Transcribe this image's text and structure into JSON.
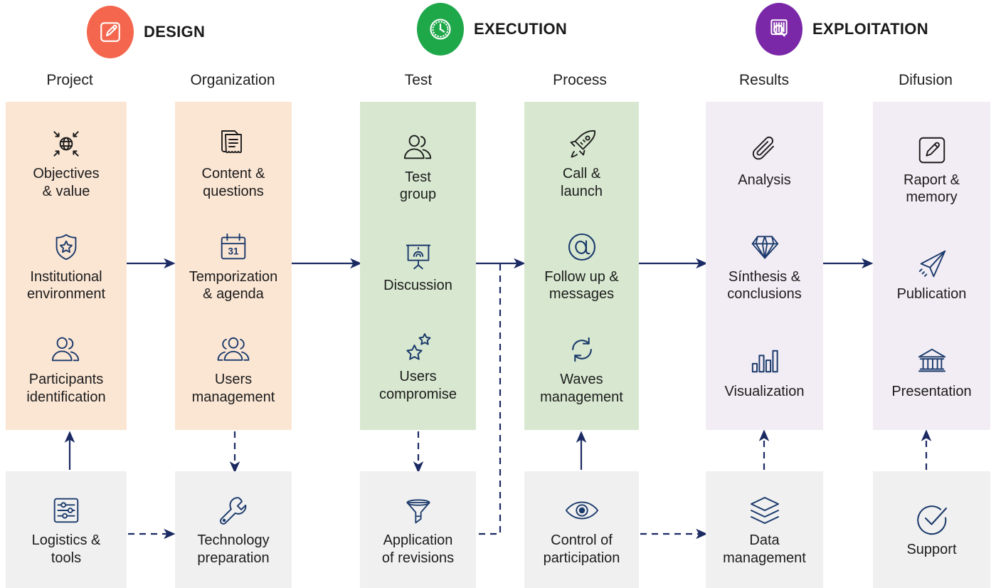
{
  "phases": [
    {
      "id": "design",
      "label": "DESIGN",
      "icon": "pencil-square-icon",
      "color": "#f4674e"
    },
    {
      "id": "execution",
      "label": "EXECUTION",
      "icon": "clock-icon",
      "color": "#1fa84a"
    },
    {
      "id": "exploitation",
      "label": "EXPLOITATION",
      "icon": "barcode-search-icon",
      "color": "#7b28a8"
    }
  ],
  "columns": [
    {
      "id": "project",
      "title": "Project"
    },
    {
      "id": "organization",
      "title": "Organization"
    },
    {
      "id": "test",
      "title": "Test"
    },
    {
      "id": "process",
      "title": "Process"
    },
    {
      "id": "results",
      "title": "Results"
    },
    {
      "id": "difusion",
      "title": "Difusion"
    }
  ],
  "main_boxes": [
    {
      "column": "project",
      "tint": "#fbe6d4",
      "items": [
        {
          "icon": "globe-target-icon",
          "label": "Objectives\n& value"
        },
        {
          "icon": "shield-star-icon",
          "label": "Institutional\nenvironment"
        },
        {
          "icon": "two-users-icon",
          "label": "Participants\nidentification"
        }
      ]
    },
    {
      "column": "organization",
      "tint": "#fbe6d4",
      "items": [
        {
          "icon": "document-stack-icon",
          "label": "Content &\nquestions"
        },
        {
          "icon": "calendar-31-icon",
          "label": "Temporization\n& agenda"
        },
        {
          "icon": "three-users-icon",
          "label": "Users\nmanagement"
        }
      ]
    },
    {
      "column": "test",
      "tint": "#d8e8d0",
      "items": [
        {
          "icon": "two-users-icon",
          "label": "Test\ngroup"
        },
        {
          "icon": "presentation-icon",
          "label": "Discussion"
        },
        {
          "icon": "stars-icon",
          "label": "Users\ncompromise"
        }
      ]
    },
    {
      "column": "process",
      "tint": "#d8e8d0",
      "items": [
        {
          "icon": "rocket-icon",
          "label": "Call &\nlaunch"
        },
        {
          "icon": "at-sign-icon",
          "label": "Follow up &\nmessages"
        },
        {
          "icon": "refresh-cycle-icon",
          "label": "Waves\nmanagement"
        }
      ]
    },
    {
      "column": "results",
      "tint": "#f2edf4",
      "items": [
        {
          "icon": "paperclip-icon",
          "label": "Analysis"
        },
        {
          "icon": "diamond-icon",
          "label": "Sínthesis &\nconclusions"
        },
        {
          "icon": "bar-chart-icon",
          "label": "Visualization"
        }
      ]
    },
    {
      "column": "difusion",
      "tint": "#f2edf4",
      "items": [
        {
          "icon": "pencil-square-outline-icon",
          "label": "Raport &\nmemory"
        },
        {
          "icon": "paper-plane-icon",
          "label": "Publication"
        },
        {
          "icon": "bank-icon",
          "label": "Presentation"
        }
      ]
    }
  ],
  "support_boxes": [
    {
      "column": "project",
      "icon": "sliders-icon",
      "label": "Logistics &\ntools",
      "tint": "#f0f0f0"
    },
    {
      "column": "organization",
      "icon": "wrench-icon",
      "label": "Technology\npreparation",
      "tint": "#f0f0f0"
    },
    {
      "column": "test",
      "icon": "funnel-icon",
      "label": "Application\nof revisions",
      "tint": "#f0f0f0"
    },
    {
      "column": "process",
      "icon": "eye-icon",
      "label": "Control of\nparticipation",
      "tint": "#f0f0f0"
    },
    {
      "column": "results",
      "icon": "layers-icon",
      "label": "Data\nmanagement",
      "tint": "#f0f0f0"
    },
    {
      "column": "difusion",
      "icon": "check-circle-icon",
      "label": "Support",
      "tint": "#f0f0f0"
    }
  ],
  "connectors": {
    "line_color": "#1b2a63",
    "solid_horizontal": [
      {
        "from": "project",
        "to": "organization"
      },
      {
        "from": "organization",
        "to": "test"
      },
      {
        "from": "test",
        "to": "process"
      },
      {
        "from": "process",
        "to": "results"
      },
      {
        "from": "results",
        "to": "difusion"
      }
    ],
    "dashed_horizontal": [
      {
        "from": "logistics-tools",
        "to": "technology-preparation"
      },
      {
        "from": "control-participation",
        "to": "data-management"
      }
    ],
    "solid_vertical_up": [
      {
        "from": "logistics-tools",
        "to": "participants-identification"
      },
      {
        "from": "control-participation",
        "to": "waves-management"
      }
    ],
    "dashed_vertical_down": [
      {
        "from": "users-management",
        "to": "technology-preparation"
      },
      {
        "from": "users-compromise",
        "to": "application-of-revisions"
      }
    ],
    "dashed_vertical_up": [
      {
        "from": "data-management",
        "to": "visualization"
      },
      {
        "from": "support",
        "to": "presentation"
      }
    ],
    "feedback_loop": {
      "from": "test-to-process-arrow",
      "to": "application-of-revisions"
    }
  },
  "palette": {
    "icon_stroke": "#1b3a6b",
    "dark_icon_stroke": "#1c1c1c",
    "text": "#1c1c1c"
  }
}
